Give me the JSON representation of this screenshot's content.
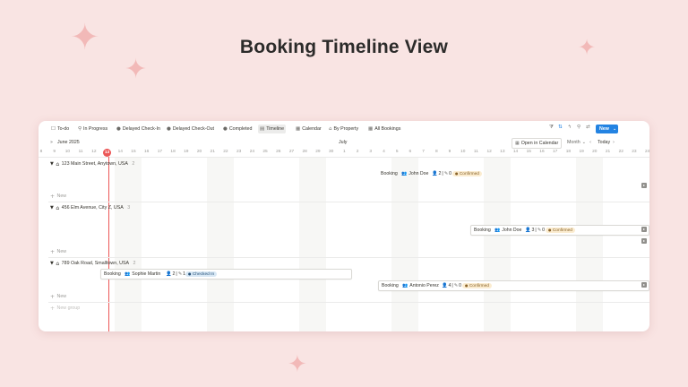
{
  "page_title": "Booking Timeline View",
  "toolbar": {
    "tabs": [
      {
        "label": "To-do",
        "icon": "square-icon"
      },
      {
        "label": "In Progress",
        "icon": "search-icon"
      },
      {
        "label": "Delayed Check-In",
        "icon": "info-icon"
      },
      {
        "label": "Delayed Check-Out",
        "icon": "info-icon"
      },
      {
        "label": "Completed",
        "icon": "filled-circle-icon"
      },
      {
        "label": "Timeline",
        "icon": "timeline-icon"
      },
      {
        "label": "Calendar",
        "icon": "calendar-icon"
      },
      {
        "label": "By Property",
        "icon": "home-icon"
      },
      {
        "label": "All Bookings",
        "icon": "table-icon"
      }
    ],
    "active_tab": "Timeline",
    "new_label": "New",
    "accent": "#2383e2"
  },
  "header": {
    "month_left": "June 2025",
    "month_center": "July",
    "open_calendar": "Open in Calendar",
    "view_mode": "Month",
    "today": "Today"
  },
  "dates": [
    "8",
    "9",
    "10",
    "11",
    "12",
    "13",
    "14",
    "15",
    "16",
    "17",
    "18",
    "19",
    "20",
    "21",
    "22",
    "23",
    "24",
    "25",
    "26",
    "27",
    "28",
    "29",
    "30",
    "1",
    "2",
    "3",
    "4",
    "5",
    "6",
    "7",
    "8",
    "9",
    "10",
    "11",
    "12",
    "13",
    "14",
    "15",
    "16",
    "17",
    "18",
    "19",
    "20",
    "21",
    "22",
    "23",
    "24"
  ],
  "today_date": "13",
  "groups": [
    {
      "name": "123 Main Street, Anytown, USA",
      "count": "2",
      "bookings": [
        {
          "name": "Booking",
          "guest": "John Doe",
          "people": "2",
          "children": "0",
          "status": "Confirmed"
        }
      ]
    },
    {
      "name": "456 Elm Avenue, City Z, USA",
      "count": "3",
      "bookings": [
        {
          "name": "Booking",
          "guest": "John Doe",
          "people": "3",
          "children": "0",
          "status": "Confirmed"
        }
      ]
    },
    {
      "name": "789 Oak Road, Smalltown, USA",
      "count": "2",
      "bookings": [
        {
          "name": "Booking",
          "guest": "Sophie Martin",
          "people": "2",
          "children": "1",
          "status": "Checked In"
        },
        {
          "name": "Booking",
          "guest": "Antonio Perez",
          "people": "4",
          "children": "0",
          "status": "Confirmed"
        }
      ]
    }
  ],
  "new_row_label": "New",
  "new_group_label": "New group",
  "colors": {
    "background": "#f9e4e3",
    "today_marker": "#eb5757",
    "confirmed_bg": "#fbecd0",
    "checked_in_bg": "#d8e8f5"
  }
}
